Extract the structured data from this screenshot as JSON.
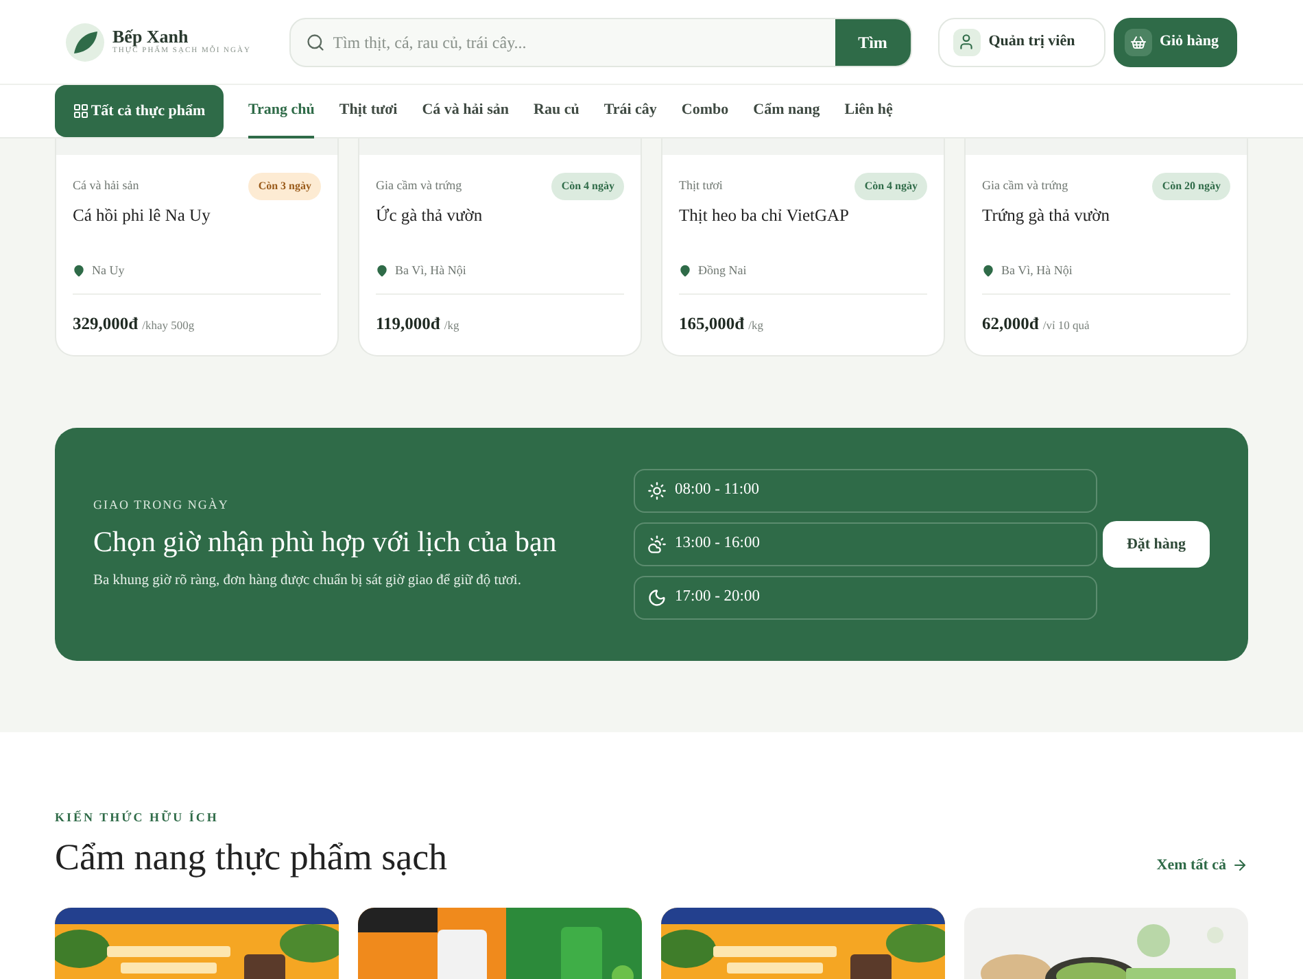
{
  "header": {
    "brand": "Bếp Xanh",
    "tagline": "THỰC PHẨM SẠCH MỖI NGÀY",
    "search": {
      "placeholder": "Tìm thịt, cá, rau củ, trái cây...",
      "button": "Tìm"
    },
    "account": "Quản trị viên",
    "cart": "Giỏ hàng"
  },
  "nav": {
    "all_button": "Tất cả thực phẩm",
    "items": [
      {
        "label": "Trang chủ",
        "selected": true
      },
      {
        "label": "Thịt tươi",
        "selected": false
      },
      {
        "label": "Cá và hải sản",
        "selected": false
      },
      {
        "label": "Rau củ",
        "selected": false
      },
      {
        "label": "Trái cây",
        "selected": false
      },
      {
        "label": "Combo",
        "selected": false
      },
      {
        "label": "Cẩm nang",
        "selected": false
      },
      {
        "label": "Liên hệ",
        "selected": false
      }
    ]
  },
  "products": [
    {
      "category": "Cá và hải sản",
      "badge": "Còn 3 ngày",
      "kind": "warning",
      "name": "Cá hồi phi lê Na Uy",
      "origin": "Na Uy",
      "price": "329,000đ",
      "unit": "/khay 500g"
    },
    {
      "category": "Gia cầm và trứng",
      "badge": "Còn 4 ngày",
      "kind": "fresh",
      "name": "Ức gà thả vườn",
      "origin": "Ba Vì, Hà Nội",
      "price": "119,000đ",
      "unit": "/kg"
    },
    {
      "category": "Thịt tươi",
      "badge": "Còn 4 ngày",
      "kind": "fresh",
      "name": "Thịt heo ba chỉ VietGAP",
      "origin": "Đồng Nai",
      "price": "165,000đ",
      "unit": "/kg"
    },
    {
      "category": "Gia cầm và trứng",
      "badge": "Còn 20 ngày",
      "kind": "fresh",
      "name": "Trứng gà thả vườn",
      "origin": "Ba Vì, Hà Nội",
      "price": "62,000đ",
      "unit": "/vỉ 10 quả"
    }
  ],
  "delivery": {
    "eyebrow": "GIAO TRONG NGÀY",
    "title": "Chọn giờ nhận phù hợp với lịch của bạn",
    "text": "Ba khung giờ rõ ràng, đơn hàng được chuẩn bị sát giờ giao để giữ độ tươi.",
    "slots": [
      {
        "kind": "morning",
        "time": "08:00 - 11:00"
      },
      {
        "kind": "afternoon",
        "time": "13:00 - 16:00"
      },
      {
        "kind": "evening",
        "time": "17:00 - 20:00"
      }
    ],
    "button": "Đặt hàng"
  },
  "guides": {
    "eyebrow": "KIẾN THỨC HỮU ÍCH",
    "title": "Cẩm nang thực phẩm sạch",
    "link": "Xem tất cả"
  }
}
